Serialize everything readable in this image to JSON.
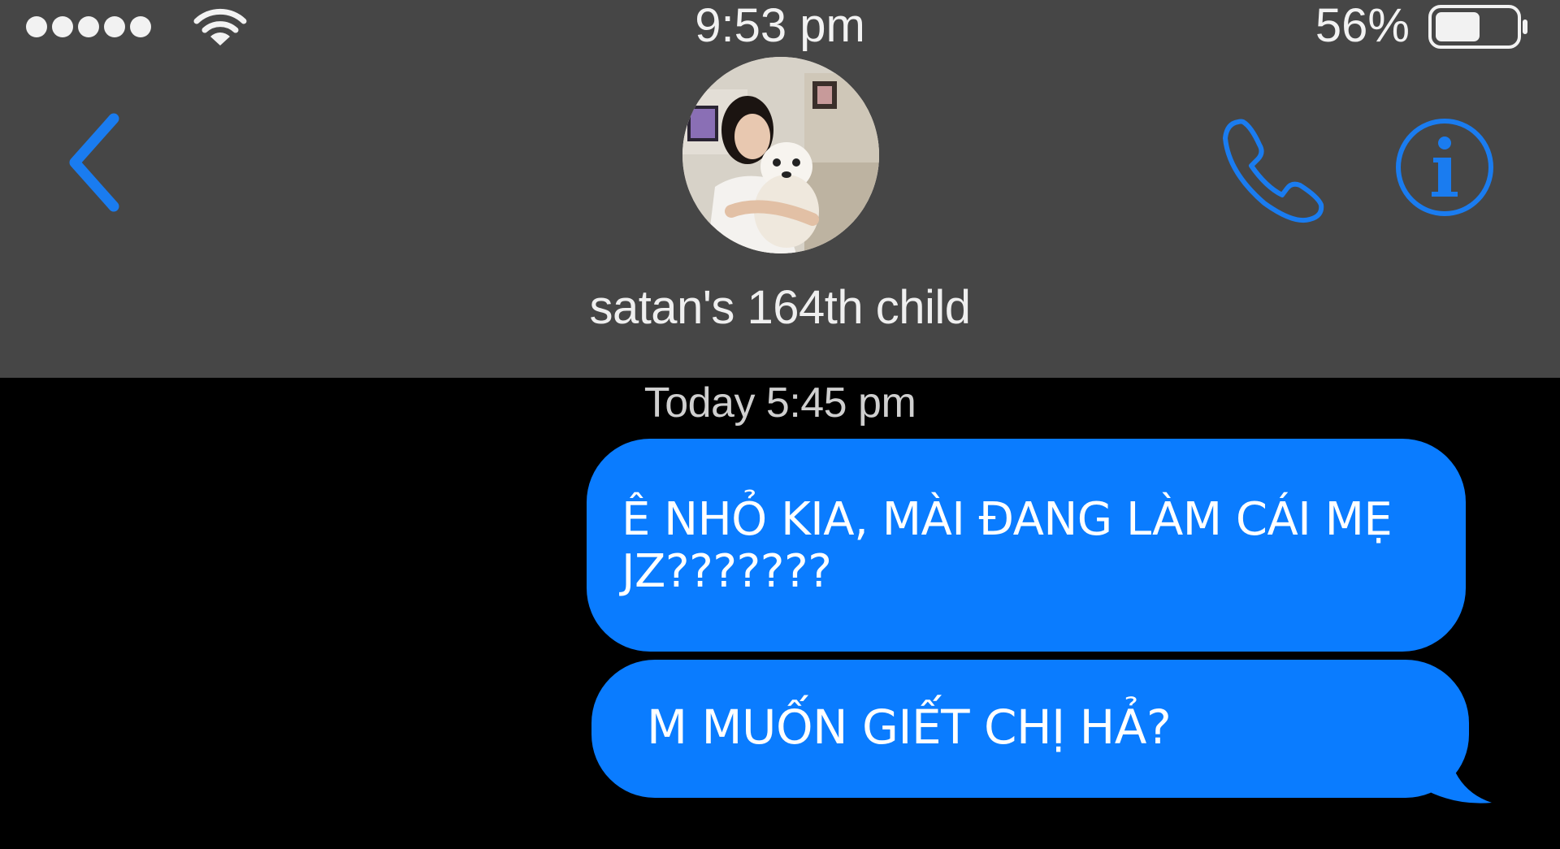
{
  "status_bar": {
    "time": "9:53 pm",
    "battery_percent": "56%",
    "battery_level": 0.56,
    "signal_bars": 5,
    "icons": [
      "signal-dots-icon",
      "wifi-icon",
      "battery-icon"
    ]
  },
  "header": {
    "contact_name": "satan's 164th child",
    "back_icon": "chevron-left-icon",
    "call_icon": "phone-icon",
    "info_icon": "info-icon"
  },
  "conversation": {
    "timestamp": "Today 5:45 pm",
    "messages": [
      {
        "text": "Ê NHỎ KIA, MÀI ĐANG LÀM CÁI MẸ JZ???????",
        "direction": "outgoing"
      },
      {
        "text": "M MUỐN GIẾT CHỊ HẢ?",
        "direction": "outgoing"
      }
    ]
  },
  "colors": {
    "accent": "#1a7cf0",
    "bubble": "#0a7cff",
    "header_bg": "#464646",
    "background": "#000000"
  }
}
